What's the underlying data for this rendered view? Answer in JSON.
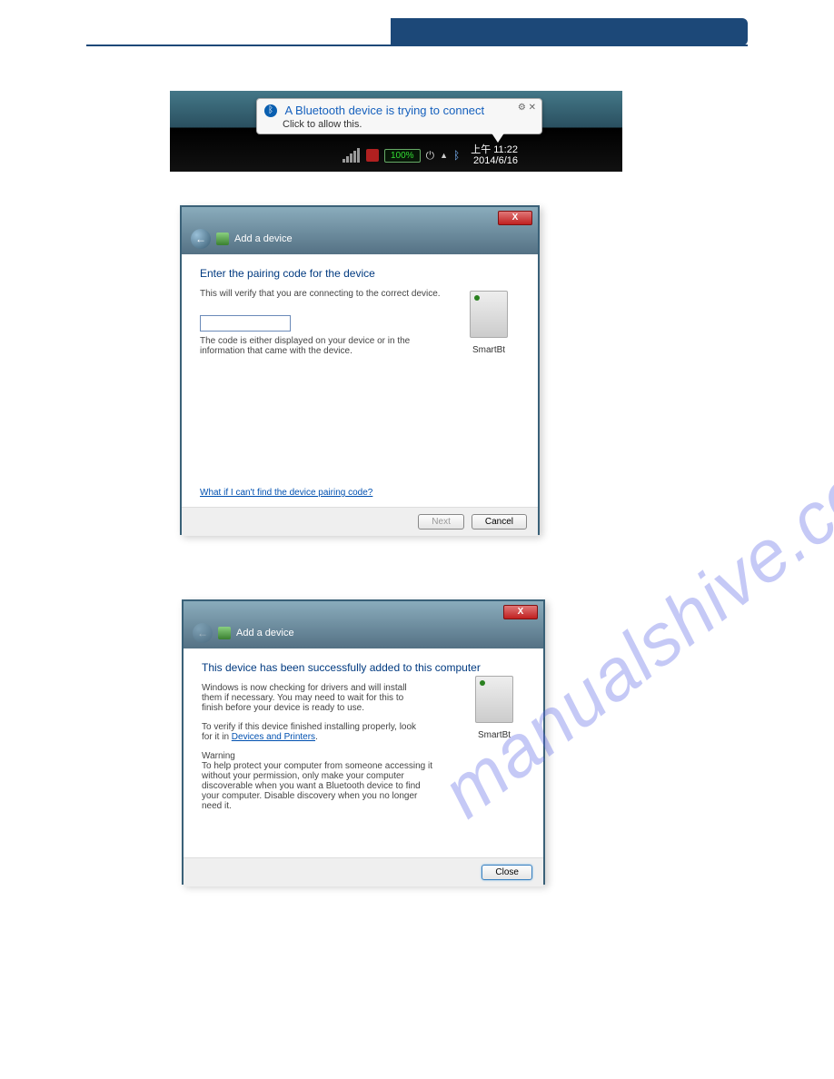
{
  "watermark": "manualshive.com",
  "notification": {
    "title": "A Bluetooth device is trying to connect",
    "subtitle": "Click to allow this."
  },
  "taskbar": {
    "battery_text": "100%",
    "clock_time": "上午 11:22",
    "clock_date": "2014/6/16"
  },
  "dialog1": {
    "window_title": "Add a device",
    "heading": "Enter the pairing code for the device",
    "description": "This will verify that you are connecting to the correct device.",
    "hint": "The code is either displayed on your device or in the information that came with the device.",
    "device_name": "SmartBt",
    "help_link": "What if I can't find the device pairing code?",
    "next_label": "Next",
    "cancel_label": "Cancel",
    "close_x": "X"
  },
  "dialog2": {
    "window_title": "Add a device",
    "heading": "This device has been successfully added to this computer",
    "paragraph1": "Windows is now checking for drivers and will install them if necessary. You may need to wait for this to finish before your device is ready to use.",
    "paragraph2_pre": "To verify if this device finished installing properly, look for it in ",
    "paragraph2_link": "Devices and Printers",
    "warning_label": "Warning",
    "warning_text": "To help protect your computer from someone accessing it without your permission, only make your computer discoverable when you want a Bluetooth device to find your computer. Disable discovery when you no longer need it.",
    "device_name": "SmartBt",
    "close_label": "Close",
    "close_x": "X"
  }
}
